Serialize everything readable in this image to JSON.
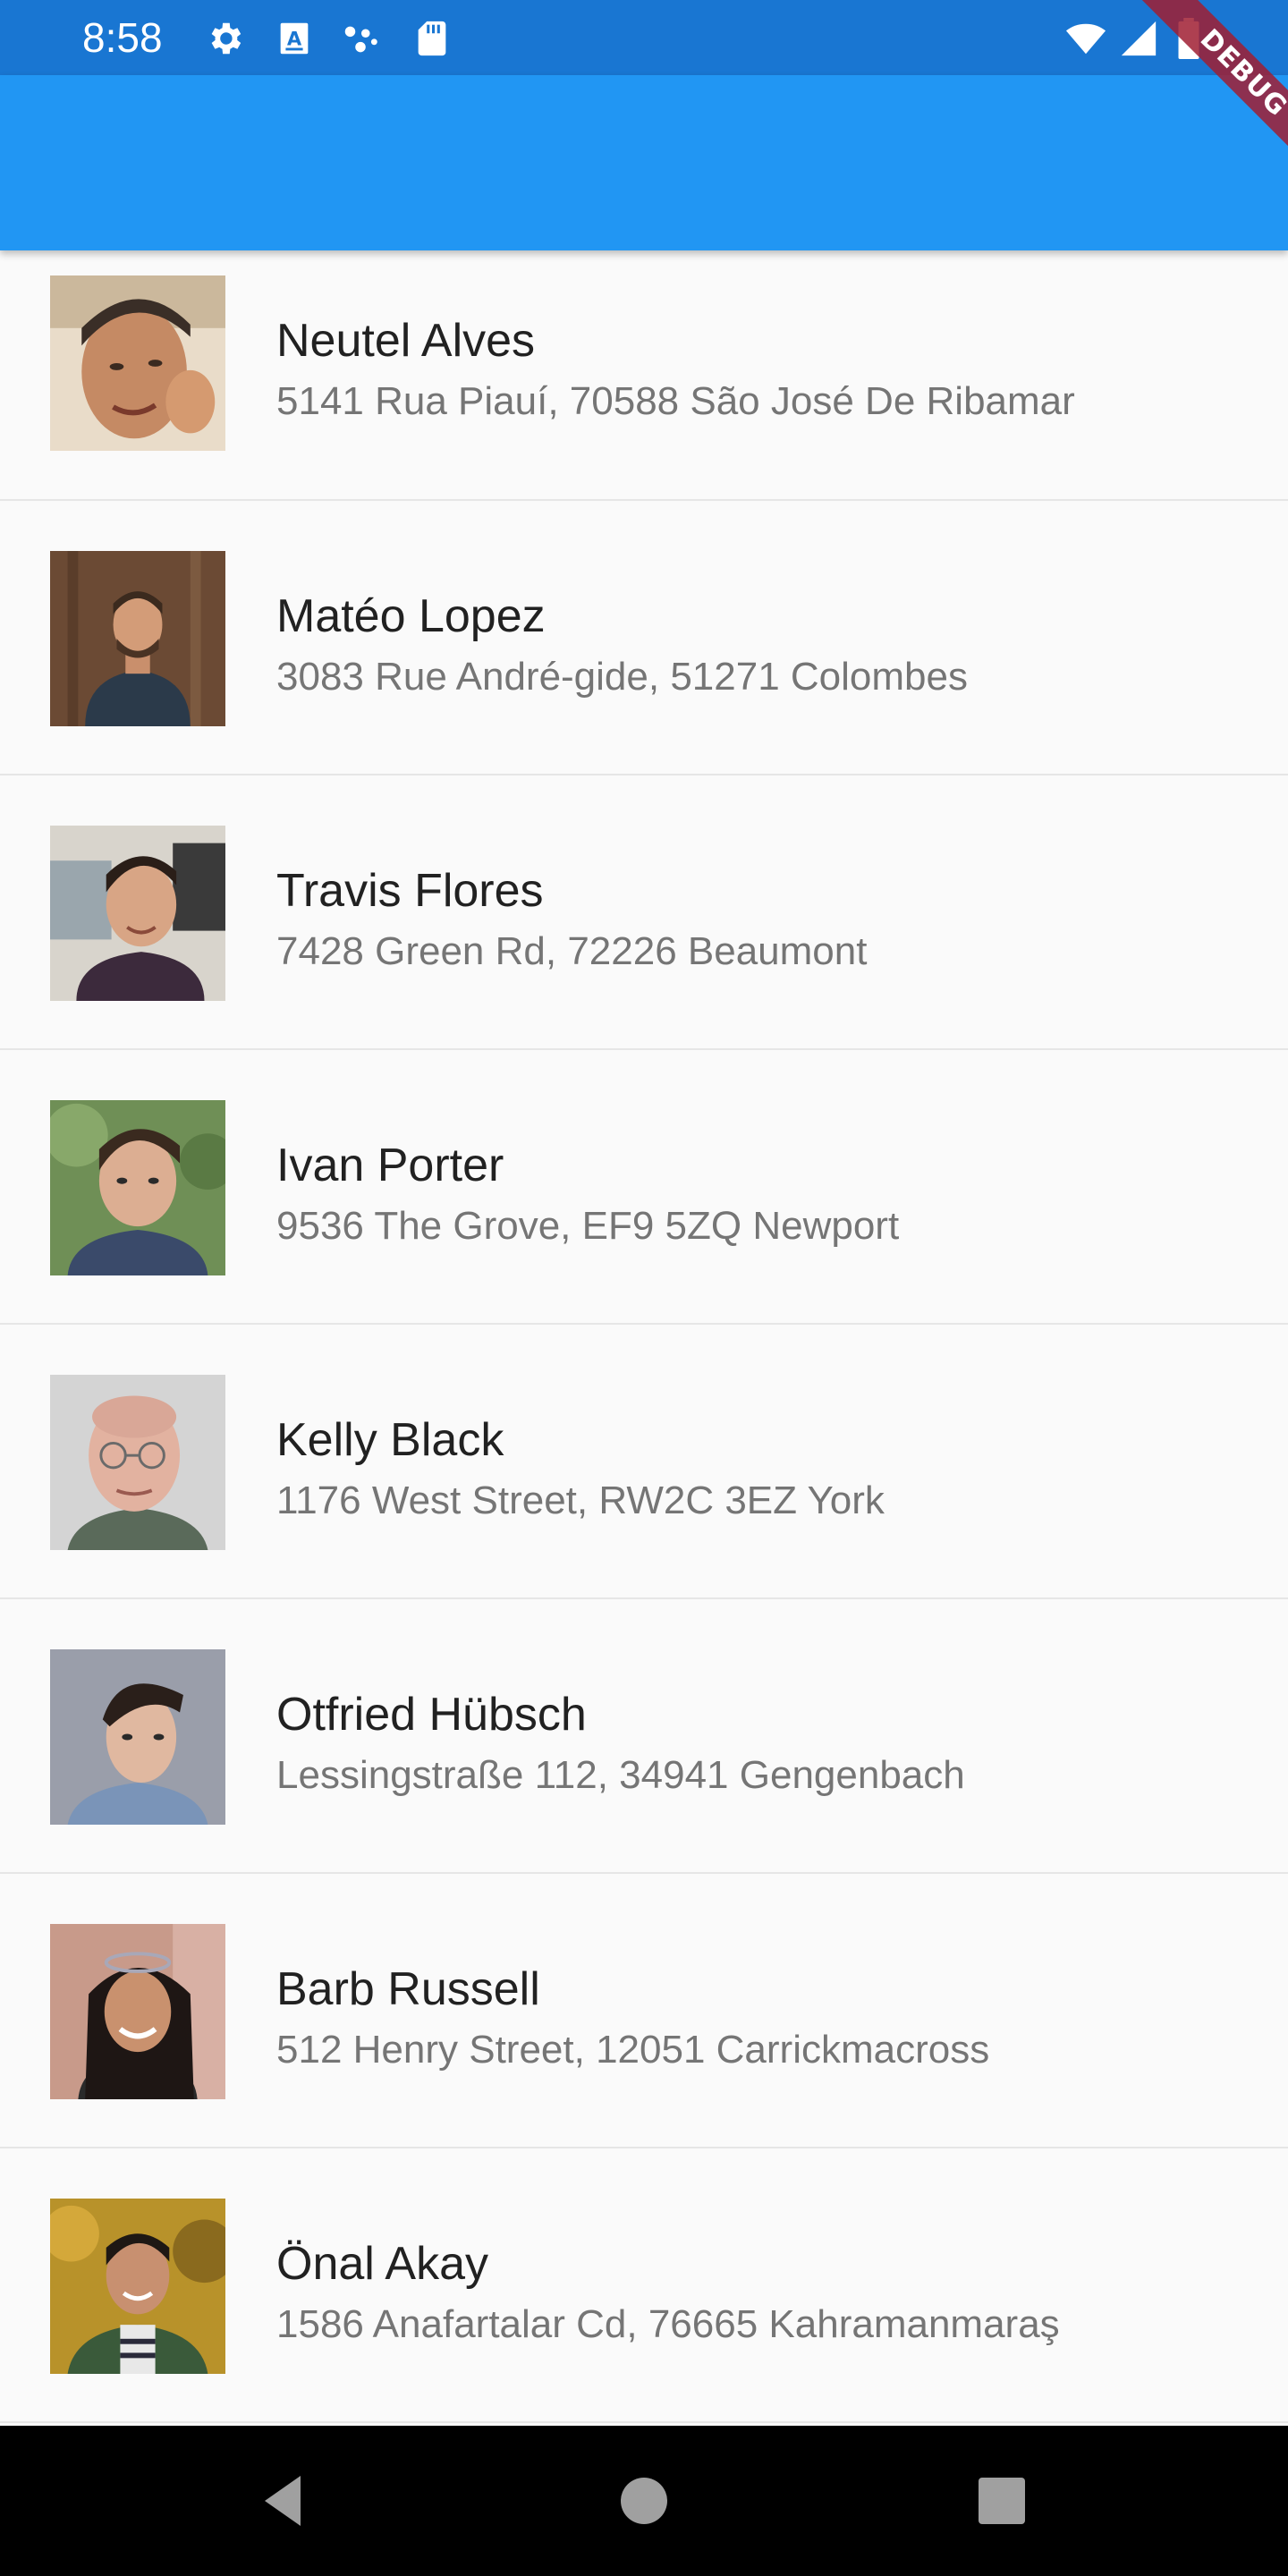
{
  "status_bar": {
    "time": "8:58",
    "left_icons": [
      "settings-icon",
      "a-badge-icon",
      "dots-icon",
      "sd-card-icon"
    ],
    "right_icons": [
      "wifi-icon",
      "signal-icon",
      "battery-icon"
    ]
  },
  "app_bar": {
    "color": "#2196f3",
    "status_color": "#1976d2"
  },
  "debug_banner": {
    "label": "DEBUG"
  },
  "users": [
    {
      "name": "Neutel Alves",
      "address": "5141 Rua Piauí, 70588 São José De Ribamar"
    },
    {
      "name": "Matéo Lopez",
      "address": "3083 Rue André-gide, 51271 Colombes"
    },
    {
      "name": "Travis Flores",
      "address": "7428 Green Rd, 72226 Beaumont"
    },
    {
      "name": "Ivan Porter",
      "address": "9536 The Grove, EF9 5ZQ Newport"
    },
    {
      "name": "Kelly Black",
      "address": "1176 West Street, RW2C 3EZ York"
    },
    {
      "name": "Otfried Hübsch",
      "address": "Lessingstraße 112, 34941 Gengenbach"
    },
    {
      "name": "Barb Russell",
      "address": "512 Henry Street, 12051 Carrickmacross"
    },
    {
      "name": "Önal Akay",
      "address": "1586 Anafartalar Cd, 76665 Kahramanmaraş"
    }
  ],
  "nav_bar": {
    "buttons": [
      "back-icon",
      "home-icon",
      "recents-icon"
    ]
  }
}
